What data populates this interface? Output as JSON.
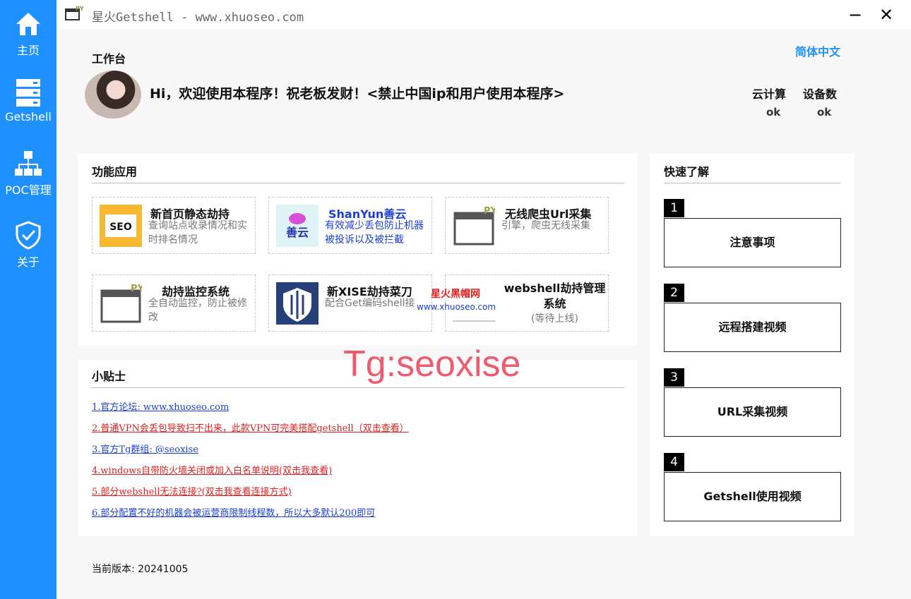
{
  "sidebar": {
    "items": [
      {
        "label": "主页",
        "icon": "home-icon"
      },
      {
        "label": "Getshell",
        "icon": "server-icon"
      },
      {
        "label": "POC管理",
        "icon": "network-icon"
      },
      {
        "label": "关于",
        "icon": "shield-check-icon"
      }
    ]
  },
  "window": {
    "title": "星火Getshell - www.xhuoseo.com",
    "minimize": "−",
    "close": "✕"
  },
  "language": "简体中文",
  "workbench": {
    "title": "工作台",
    "welcome": "Hi，欢迎使用本程序！祝老板发财！<禁止中国ip和用户使用本程序>",
    "stats": [
      {
        "label": "云计算",
        "value": "ok"
      },
      {
        "label": "设备数",
        "value": "ok"
      }
    ]
  },
  "functions": {
    "title": "功能应用",
    "cards": [
      {
        "title": "新首页静态劫持",
        "desc": "查询站点收录情况和实时排名情况",
        "icon": "seo-icon"
      },
      {
        "title": "ShanYun善云",
        "desc": "有效减少丢包防止机器被投诉以及被拦截",
        "icon": "shanyun-logo-icon"
      },
      {
        "title": "无线爬虫Url采集",
        "desc": "引擎，爬虫无线采集",
        "icon": "py-window-icon"
      },
      {
        "title": "劫持监控系统",
        "desc": "全自动监控，防止被修改",
        "icon": "py-window-icon"
      },
      {
        "title": "新XISE劫持菜刀",
        "desc": "配合Get编码shell接",
        "icon": "wings-shield-icon"
      },
      {
        "title": "webshell劫持管理系统",
        "desc": "(等待上线)",
        "icon": "py-window-icon"
      }
    ]
  },
  "tips": {
    "title": "小贴士",
    "items": [
      {
        "text": "1.官方论坛: www.xhuoseo.com",
        "color": "blue"
      },
      {
        "text": "2.普通VPN会丢包导致扫不出来，此款VPN可完美搭配getshell（双击查看）",
        "color": "red"
      },
      {
        "text": "3.官方Tg群组: @seoxise",
        "color": "blue"
      },
      {
        "text": "4.windows自带防火墙关闭或加入白名单说明(双击我查看)",
        "color": "red"
      },
      {
        "text": "5.部分webshell无法连接?(双击我查看连接方式)",
        "color": "red"
      },
      {
        "text": "6.部分配置不好的机器会被运营商限制线程数，所以大多默认200即可",
        "color": "blue"
      }
    ]
  },
  "quick": {
    "title": "快速了解",
    "items": [
      {
        "num": "1",
        "label": "注意事项"
      },
      {
        "num": "2",
        "label": "远程搭建视频"
      },
      {
        "num": "3",
        "label": "URL采集视频"
      },
      {
        "num": "4",
        "label": "Getshell使用视频"
      }
    ]
  },
  "watermarks": {
    "big": "Tg:seoxise",
    "small1": "星火黑帽网",
    "small2": "www.xhuoseo.com"
  },
  "version": "当前版本: 20241005",
  "colors": {
    "accent": "#1e90ff",
    "link_blue": "#1a3fd6",
    "link_red": "#e02020",
    "watermark": "#ef5a6f"
  }
}
